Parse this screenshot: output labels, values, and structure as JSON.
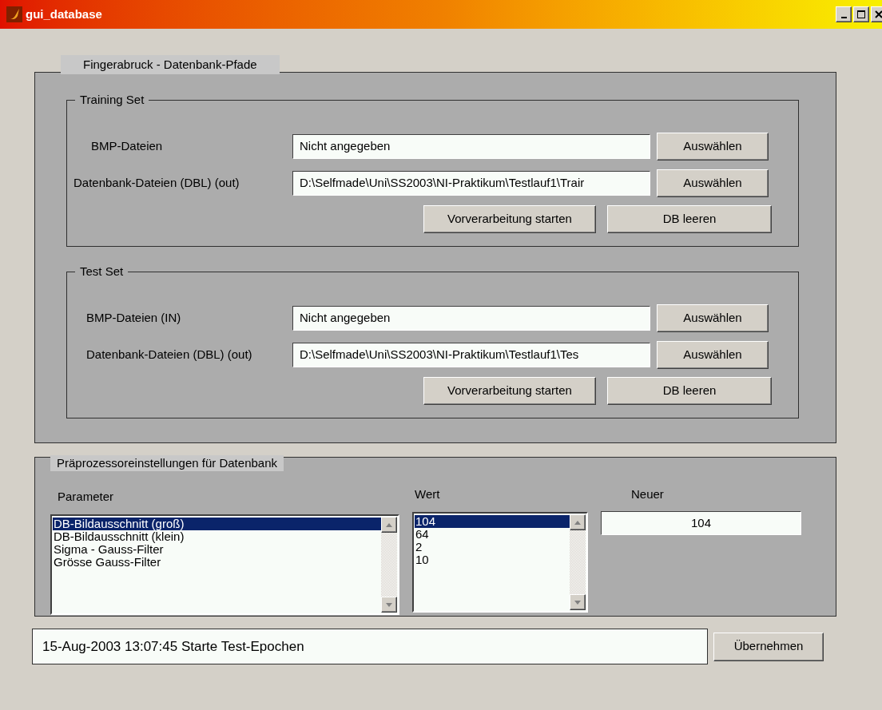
{
  "window": {
    "title": "gui_database"
  },
  "paths_panel": {
    "title": "Fingerabruck - Datenbank-Pfade",
    "sets": [
      {
        "title": "Training Set",
        "rows": [
          {
            "label": "BMP-Dateien",
            "value": "Nicht angegeben",
            "button": "Auswählen"
          },
          {
            "label": "Datenbank-Dateien  (DBL) (out)",
            "value": "D:\\Selfmade\\Uni\\SS2003\\NI-Praktikum\\Testlauf1\\Trair",
            "button": "Auswählen"
          }
        ],
        "actions": [
          "Vorverarbeitung starten",
          "DB leeren"
        ]
      },
      {
        "title": "Test Set",
        "rows": [
          {
            "label": "BMP-Dateien (IN)",
            "value": "Nicht angegeben",
            "button": "Auswählen"
          },
          {
            "label": "Datenbank-Dateien  (DBL) (out)",
            "value": "D:\\Selfmade\\Uni\\SS2003\\NI-Praktikum\\Testlauf1\\Tes",
            "button": "Auswählen"
          }
        ],
        "actions": [
          "Vorverarbeitung starten",
          "DB leeren"
        ]
      }
    ]
  },
  "preprocessor_panel": {
    "title": "Präprozessoreinstellungen für Datenbank",
    "parameter_label": "Parameter",
    "parameters": [
      {
        "label": "DB-Bildausschnitt (groß)",
        "selected": true
      },
      {
        "label": "DB-Bildausschnitt (klein)",
        "selected": false
      },
      {
        "label": "Sigma - Gauss-Filter",
        "selected": false
      },
      {
        "label": "Grösse Gauss-Filter",
        "selected": false
      }
    ],
    "value_label": "Wert",
    "values": [
      {
        "label": "104",
        "selected": true
      },
      {
        "label": "64",
        "selected": false
      },
      {
        "label": "2",
        "selected": false
      },
      {
        "label": "10",
        "selected": false
      }
    ],
    "new_label": "Neuer",
    "new_value": "104"
  },
  "status": "15-Aug-2003 13:07:45 Starte Test-Epochen",
  "apply_button": "Übernehmen"
}
